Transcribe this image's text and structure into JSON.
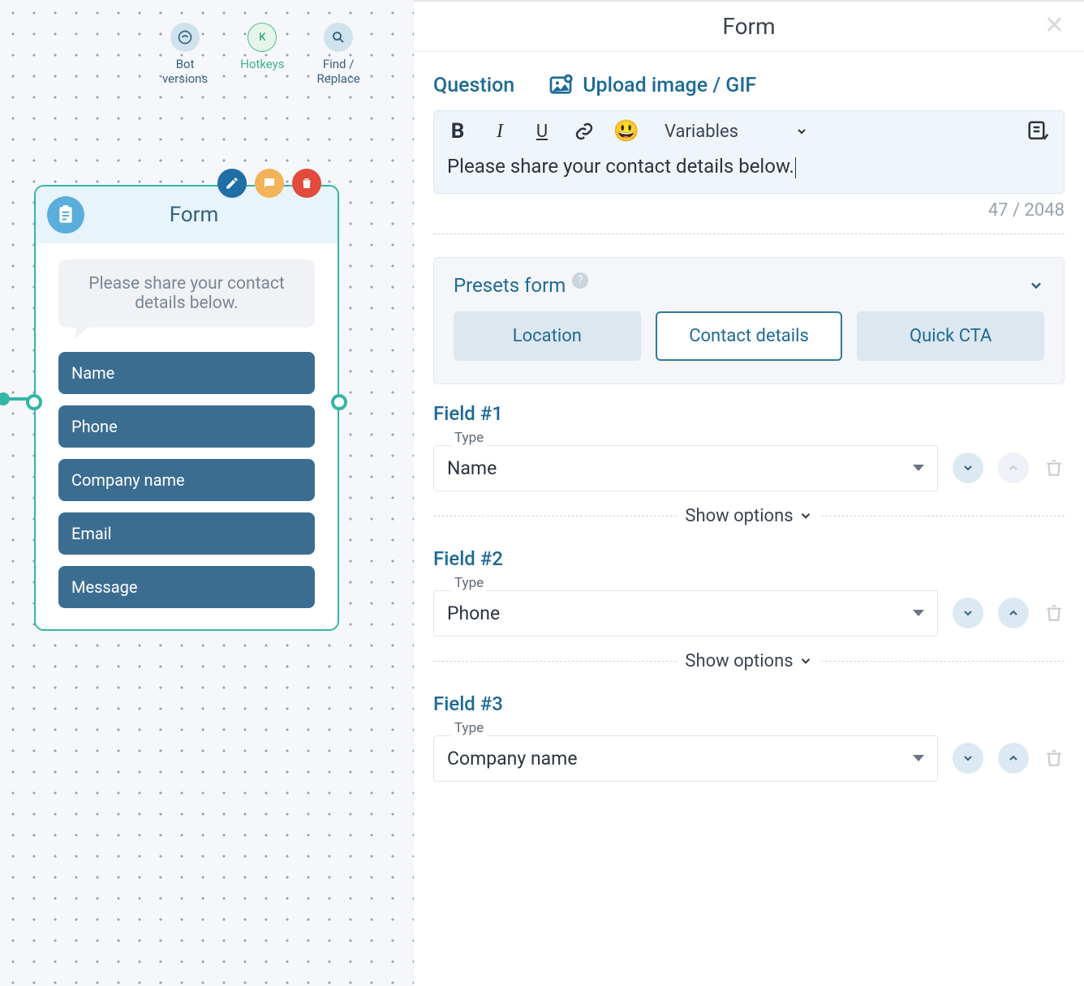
{
  "canvas": {
    "tools": {
      "versions": "Bot\nversions",
      "hotkeys": "Hotkeys",
      "find": "Find /\nReplace"
    },
    "node": {
      "title": "Form",
      "message": "Please share your contact details below.",
      "fields": [
        "Name",
        "Phone",
        "Company name",
        "Email",
        "Message"
      ]
    }
  },
  "panel": {
    "title": "Form",
    "question_label": "Question",
    "upload_label": "Upload image / GIF",
    "variables_label": "Variables",
    "question_text": "Please share your contact details below.",
    "counter": "47 / 2048",
    "presets": {
      "title": "Presets form",
      "options": [
        "Location",
        "Contact details",
        "Quick CTA"
      ],
      "active_index": 1
    },
    "type_label": "Type",
    "show_options": "Show options",
    "fields": [
      {
        "title": "Field #1",
        "type": "Name",
        "up_disabled": true
      },
      {
        "title": "Field #2",
        "type": "Phone",
        "up_disabled": false
      },
      {
        "title": "Field #3",
        "type": "Company name",
        "up_disabled": false
      }
    ]
  }
}
